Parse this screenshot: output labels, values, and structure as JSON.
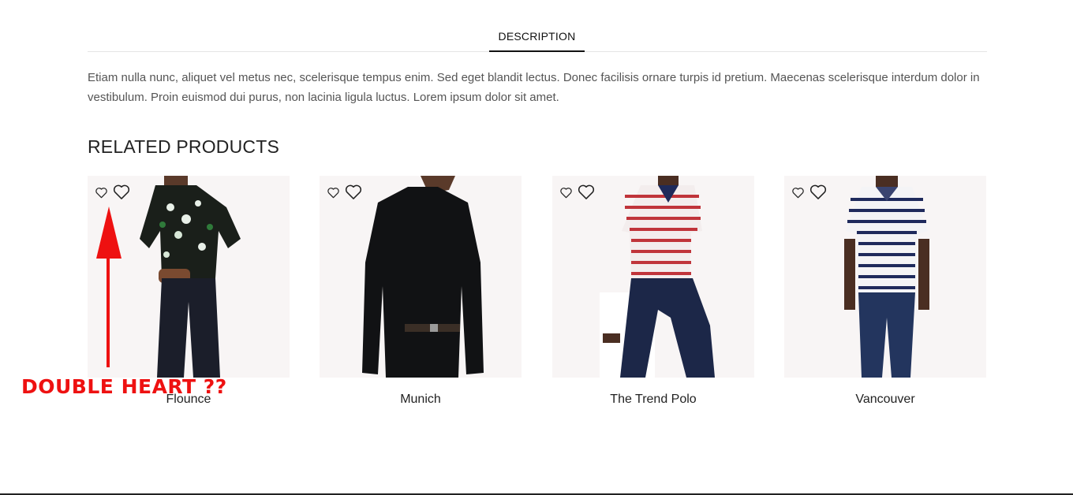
{
  "tabs": [
    {
      "label": "DESCRIPTION",
      "active": true
    }
  ],
  "description": "Etiam nulla nunc, aliquet vel metus nec, scelerisque tempus enim. Sed eget blandit lectus. Donec facilisis ornare turpis id pretium. Maecenas scelerisque interdum dolor in vestibulum. Proin euismod dui purus, non lacinia ligula luctus. Lorem ipsum dolor sit amet.",
  "related": {
    "title": "RELATED PRODUCTS",
    "products": [
      {
        "name": "Flounce",
        "icons": [
          "heart-outline-small-icon",
          "heart-outline-icon"
        ]
      },
      {
        "name": "Munich",
        "icons": [
          "heart-outline-small-icon",
          "heart-outline-icon"
        ]
      },
      {
        "name": "The Trend Polo",
        "icons": [
          "heart-outline-small-icon",
          "heart-outline-icon"
        ]
      },
      {
        "name": "Vancouver",
        "icons": [
          "heart-outline-small-icon",
          "heart-outline-icon"
        ]
      }
    ]
  },
  "annotation": {
    "text": "DOUBLE HEART ??",
    "color": "#ee1111"
  },
  "colors": {
    "image_background": "#f8f5f5",
    "tab_underline": "#111111",
    "text": "#555555"
  }
}
